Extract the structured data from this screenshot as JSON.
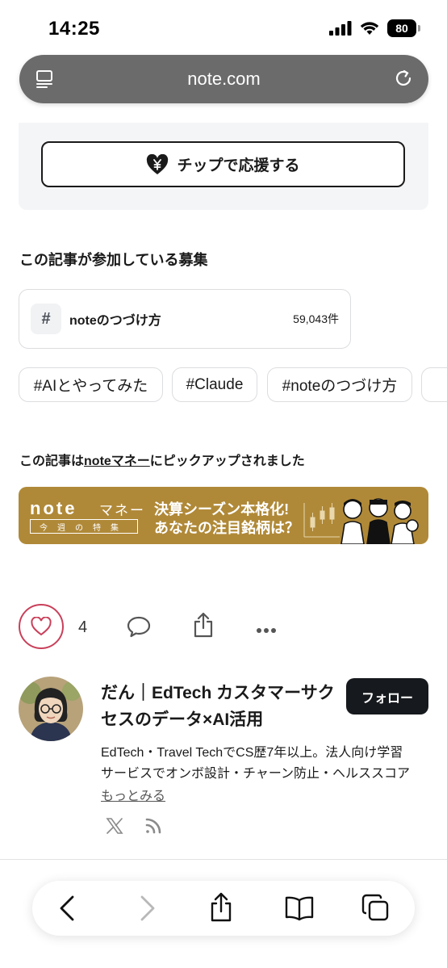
{
  "status": {
    "time": "14:25",
    "battery": "80"
  },
  "browser": {
    "url": "note.com"
  },
  "tip": {
    "label": "チップで応援する"
  },
  "contests": {
    "heading": "この記事が参加している募集",
    "card": {
      "hash": "#",
      "name": "noteのつづけ方",
      "count": "59,043件"
    },
    "chips": [
      "#AIとやってみた",
      "#Claude",
      "#noteのつづけ方"
    ]
  },
  "pickup": {
    "prefix": "この記事は",
    "link": "noteマネー",
    "suffix": "にピックアップされました"
  },
  "banner": {
    "logo": "note",
    "logo_sub": "マネー",
    "weekly": "今週の特集",
    "line1": "決算シーズン本格化!",
    "line2": "あなたの注目銘柄は？",
    "colors": {
      "bg": "#b08938"
    }
  },
  "actions": {
    "like_count": "4"
  },
  "author": {
    "name": "だん｜EdTech カスタマーサクセスのデータ×AI活用",
    "follow_label": "フォロー",
    "bio_line1": "EdTech・Travel TechでCS歴7年以上。法人向け学習",
    "bio_line2": "サービスでオンボ設計・チャーン防止・ヘルススコア",
    "more_label": "もっとみる"
  },
  "icons": [
    "reader-icon",
    "reload-icon",
    "heart-yen-icon",
    "heart-icon",
    "comment-icon",
    "share-icon",
    "more-icon",
    "x-icon",
    "rss-icon",
    "back-icon",
    "forward-icon",
    "share-icon",
    "bookmarks-icon",
    "tabs-icon"
  ],
  "accent": {
    "like": "#c9405a",
    "follow": "#16191d"
  }
}
